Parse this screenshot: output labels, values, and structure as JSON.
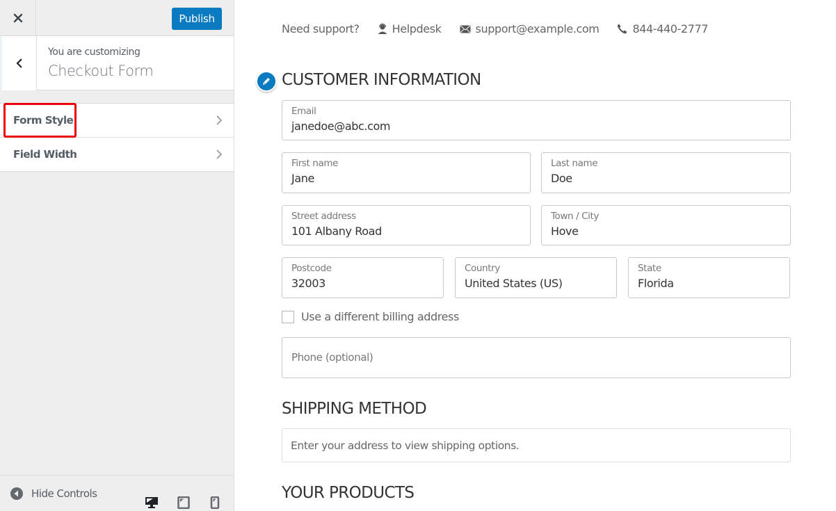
{
  "sidebar": {
    "close_label": "Close",
    "publish_label": "Publish",
    "customizing_label": "You are customizing",
    "section_title": "Checkout Form",
    "menu_items": [
      {
        "label": "Form Style",
        "highlighted": true
      },
      {
        "label": "Field Width",
        "highlighted": false
      }
    ],
    "footer": {
      "hide_controls_label": "Hide Controls",
      "devices": [
        "desktop",
        "tablet",
        "mobile"
      ],
      "active_device": "desktop"
    }
  },
  "preview": {
    "support": {
      "prefix": "Need support?",
      "helpdesk": "Helpdesk",
      "email": "support@example.com",
      "phone": "844-440-2777"
    },
    "customer_info": {
      "heading": "CUSTOMER INFORMATION",
      "fields": {
        "email": {
          "label": "Email",
          "value": "janedoe@abc.com"
        },
        "first_name": {
          "label": "First name",
          "value": "Jane"
        },
        "last_name": {
          "label": "Last name",
          "value": "Doe"
        },
        "street_address": {
          "label": "Street address",
          "value": "101 Albany Road"
        },
        "city": {
          "label": "Town / City",
          "value": "Hove"
        },
        "postcode": {
          "label": "Postcode",
          "value": "32003"
        },
        "country": {
          "label": "Country",
          "value": "United States (US)"
        },
        "state": {
          "label": "State",
          "value": "Florida"
        },
        "phone": {
          "placeholder": "Phone (optional)",
          "value": ""
        }
      },
      "billing_checkbox": {
        "label": "Use a different billing address",
        "checked": false
      }
    },
    "shipping": {
      "heading": "SHIPPING METHOD",
      "message": "Enter your address to view shipping options."
    },
    "products": {
      "heading": "YOUR PRODUCTS"
    }
  },
  "colors": {
    "accent": "#0a7bc1",
    "highlight": "#e8000b",
    "sidebar_bg": "#eeeeee"
  }
}
